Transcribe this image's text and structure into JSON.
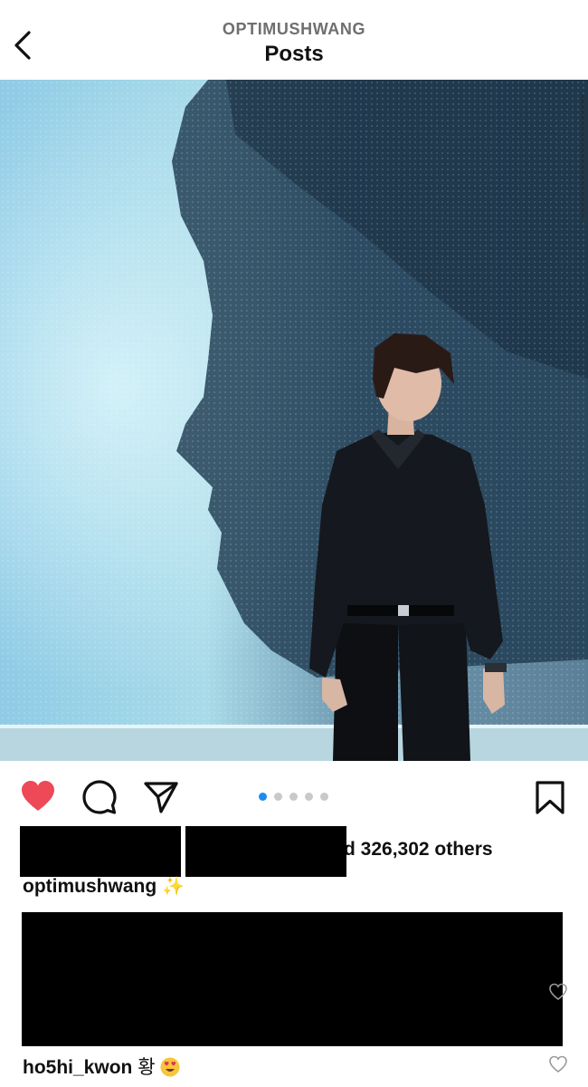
{
  "header": {
    "username": "OPTIMUSHWANG",
    "title": "Posts"
  },
  "post": {
    "image_description_icon": "photo-image",
    "carousel": {
      "total": 5,
      "active_index": 0
    },
    "likes_text": "d 326,302 others",
    "caption": {
      "username": "optimushwang",
      "text": "✨"
    },
    "comments": [
      {
        "username": "ho5hi_kwon",
        "text": "황"
      }
    ]
  },
  "colors": {
    "like_red": "#ed4956",
    "dot_active": "#1d8cf0",
    "dot_inactive": "#c9c9c9"
  },
  "icons": {
    "back": "chevron-left-icon",
    "like": "heart-filled-icon",
    "comment": "speech-bubble-icon",
    "share": "paper-plane-icon",
    "save": "bookmark-icon",
    "comment_like": "heart-outline-icon"
  }
}
